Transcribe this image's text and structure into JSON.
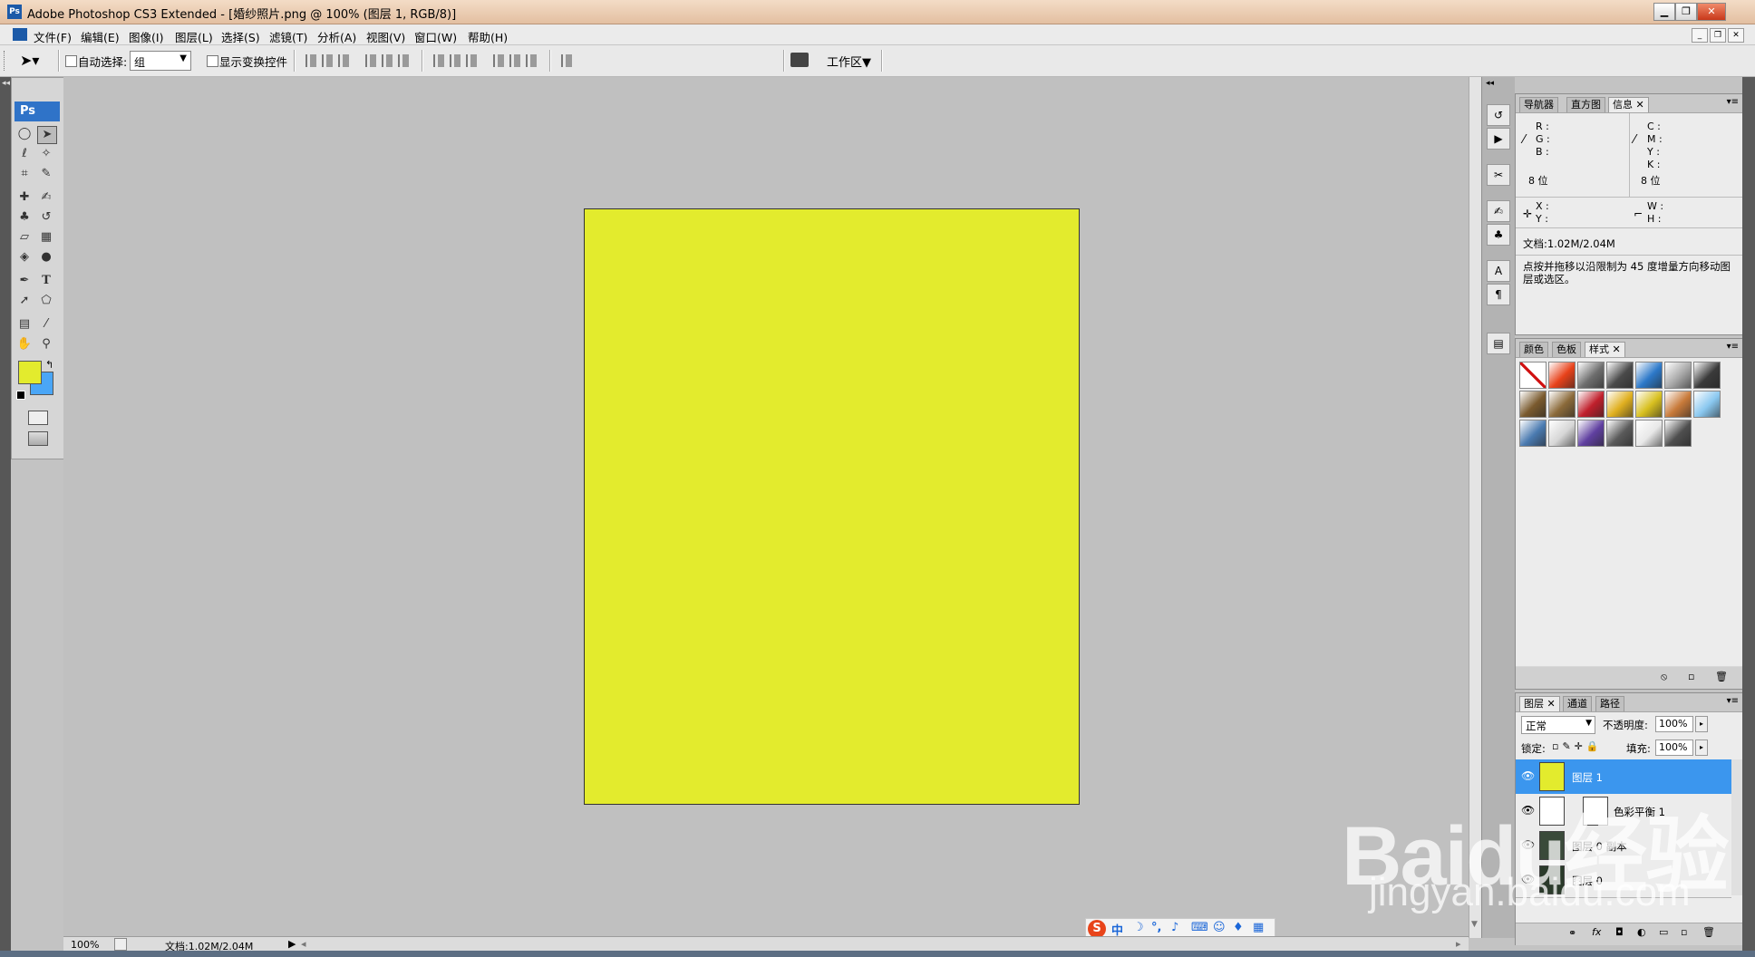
{
  "window": {
    "app_icon": "Ps",
    "title": "Adobe Photoshop CS3 Extended - [婚纱照片.png @ 100% (图层 1, RGB/8)]"
  },
  "menu": [
    "文件(F)",
    "编辑(E)",
    "图像(I)",
    "图层(L)",
    "选择(S)",
    "滤镜(T)",
    "分析(A)",
    "视图(V)",
    "窗口(W)",
    "帮助(H)"
  ],
  "options_bar": {
    "auto_select_label": "自动选择:",
    "auto_select_value": "组",
    "show_transform_label": "显示变换控件",
    "workspace_label": "工作区▼"
  },
  "toolbox": {
    "logo": "Ps",
    "tools": [
      "marquee-icon",
      "move-icon",
      "lasso-icon",
      "magic-wand-icon",
      "crop-icon",
      "slice-icon",
      "healing-brush-icon",
      "brush-icon",
      "clone-stamp-icon",
      "history-brush-icon",
      "eraser-icon",
      "gradient-icon",
      "blur-icon",
      "dodge-icon",
      "pen-icon",
      "type-icon",
      "path-selection-icon",
      "shape-icon",
      "notes-icon",
      "eyedropper-icon",
      "hand-icon",
      "zoom-icon"
    ],
    "foreground_color": "#e3eb2d",
    "background_color": "#4aa6f6"
  },
  "info_panel": {
    "tabs": [
      "导航器",
      "直方图",
      "信息"
    ],
    "active_tab": "信息",
    "rgb_labels": [
      "R :",
      "G :",
      "B :"
    ],
    "cmyk_labels": [
      "C :",
      "M :",
      "Y :",
      "K :"
    ],
    "bit_left": "8 位",
    "bit_right": "8 位",
    "xy_labels": [
      "X :",
      "Y :"
    ],
    "wh_labels": [
      "W :",
      "H :"
    ],
    "doc_info": "文档:1.02M/2.04M",
    "hint": "点按并拖移以沿限制为 45 度增量方向移动图层或选区。"
  },
  "styles_panel": {
    "tabs": [
      "颜色",
      "色板",
      "样式"
    ],
    "active_tab": "样式",
    "swatches": [
      "#ffffff",
      "#e8421a",
      "#6e6e6e",
      "#4a4a4a",
      "#2d79c9",
      "#a9a9a9",
      "#3a3a3a",
      "#7a5a2e",
      "#8b6a3a",
      "#c0202c",
      "#e0b020",
      "#d8c020",
      "#c87a3a",
      "#8ac8f0",
      "#4a7ab0",
      "#d6d6d6",
      "#6040a0",
      "#5a5a5a",
      "#e8e8e8",
      "#4e4e4e"
    ]
  },
  "layers_panel": {
    "tabs": [
      "图层",
      "通道",
      "路径"
    ],
    "active_tab": "图层",
    "blend_mode": "正常",
    "opacity_label": "不透明度:",
    "opacity_value": "100%",
    "lock_label": "锁定:",
    "fill_label": "填充:",
    "fill_value": "100%",
    "layers": [
      {
        "name": "图层 1",
        "selected": true,
        "thumb_color": "#e3eb2d"
      },
      {
        "name": "色彩平衡 1",
        "selected": false,
        "thumb_color": "#ffffff"
      },
      {
        "name": "图层 0 副本",
        "selected": false,
        "thumb_color": "#3a4a3a"
      },
      {
        "name": "图层 0",
        "selected": false,
        "thumb_color": "#2a3a2a"
      }
    ]
  },
  "status": {
    "zoom": "100%",
    "doc": "文档:1.02M/2.04M"
  },
  "ime": {
    "logo": "S",
    "mode": "中"
  },
  "watermark": {
    "line1": "Baidu经验",
    "line2": "jingyan.baidu.com"
  }
}
